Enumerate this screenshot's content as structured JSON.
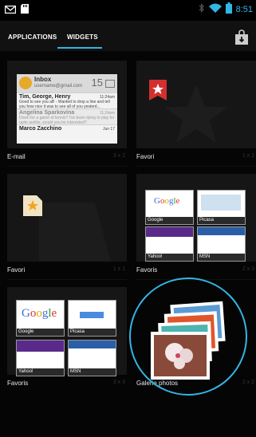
{
  "status_bar": {
    "time": "8:51",
    "icons": [
      "mail-icon",
      "sd-card-icon",
      "bluetooth-icon",
      "wifi-icon",
      "battery-icon"
    ],
    "accent_color": "#33b5e5"
  },
  "tabs": [
    {
      "label": "APPLICATIONS",
      "selected": false
    },
    {
      "label": "WIDGETS",
      "selected": true
    }
  ],
  "widgets": [
    {
      "name": "E-mail",
      "size": "3 x 2",
      "preview": {
        "inbox_title": "Inbox",
        "inbox_account": "username@gmail.com",
        "inbox_count": "15",
        "messages": [
          {
            "sender": "Tim, George, Henry",
            "time": "11:24am",
            "snippet": "Good to see you all! - Wanted to drop a line and tell you how nice it was to see all of you yesterd..."
          },
          {
            "sender": "Angelina Sparkovina",
            "time": "11:24am",
            "snippet": "Down for a game of tennis? I've been dying to play for quite awhile, would you be interested?"
          },
          {
            "sender": "Marco Zacchino",
            "time": "Jun 17",
            "snippet": ""
          }
        ]
      }
    },
    {
      "name": "Favori",
      "size": "1 x 1"
    },
    {
      "name": "Favori",
      "size": "1 x 1"
    },
    {
      "name": "Favoris",
      "size": "2 x 3",
      "preview": {
        "thumbnails": [
          "Google",
          "Picasa",
          "Yahoo!",
          "MSN"
        ]
      }
    },
    {
      "name": "Favoris",
      "size": "3 x 3",
      "preview": {
        "thumbnails": [
          "Google",
          "Picasa",
          "Yahoo!",
          "MSN"
        ]
      }
    },
    {
      "name": "Galerie photos",
      "size": "2 x 2"
    }
  ]
}
